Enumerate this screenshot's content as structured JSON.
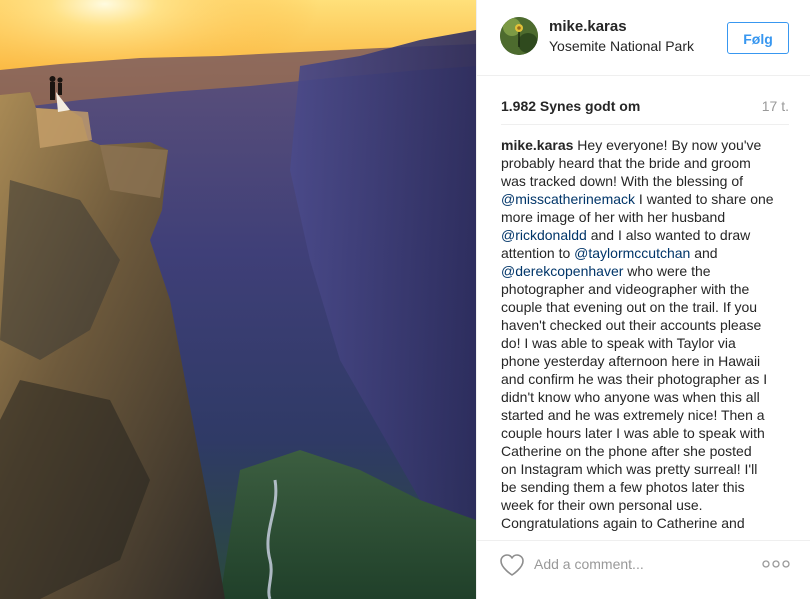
{
  "post": {
    "username": "mike.karas",
    "location": "Yosemite National Park",
    "follow_label": "Følg",
    "likes": "1.982 Synes godt om",
    "time": "17 t.",
    "caption": {
      "username": "mike.karas",
      "lines": [
        [
          {
            "t": "Hey everyone! By now you've"
          }
        ],
        [
          {
            "t": "probably heard that the bride and groom"
          }
        ],
        [
          {
            "t": "was tracked down! With the blessing of"
          }
        ],
        [
          {
            "t": "@misscatherinemack",
            "m": true
          },
          {
            "t": " I wanted to share one"
          }
        ],
        [
          {
            "t": "more image of her with her husband"
          }
        ],
        [
          {
            "t": "@rickdonaldd",
            "m": true
          },
          {
            "t": " and I also wanted to draw"
          }
        ],
        [
          {
            "t": "attention to "
          },
          {
            "t": "@taylormccutchan",
            "m": true
          },
          {
            "t": " and"
          }
        ],
        [
          {
            "t": "@derekcopenhaver",
            "m": true
          },
          {
            "t": " who were the"
          }
        ],
        [
          {
            "t": "photographer and videographer with the"
          }
        ],
        [
          {
            "t": "couple that evening out on the trail. If you"
          }
        ],
        [
          {
            "t": "haven't checked out their accounts please"
          }
        ],
        [
          {
            "t": "do! I was able to speak with Taylor via"
          }
        ],
        [
          {
            "t": "phone yesterday afternoon here in Hawaii"
          }
        ],
        [
          {
            "t": "and confirm he was their photographer as I"
          }
        ],
        [
          {
            "t": "didn't know who anyone was when this all"
          }
        ],
        [
          {
            "t": "started and he was extremely nice! Then a"
          }
        ],
        [
          {
            "t": "couple hours later I was able to speak with"
          }
        ],
        [
          {
            "t": "Catherine on the phone after she posted"
          }
        ],
        [
          {
            "t": "on Instagram which was pretty surreal! I'll"
          }
        ],
        [
          {
            "t": "be sending them a few photos later this"
          }
        ],
        [
          {
            "t": "week for their own personal use."
          }
        ],
        [
          {
            "t": "Congratulations again to Catherine and"
          }
        ]
      ]
    },
    "comment_placeholder": "Add a comment...",
    "more_options_label": "ooo"
  },
  "icons": {
    "like": "heart-outline-icon",
    "more": "more-options-icon"
  },
  "colors": {
    "accent": "#3897f0",
    "mention": "#003569",
    "muted": "#999999",
    "text": "#262626"
  }
}
